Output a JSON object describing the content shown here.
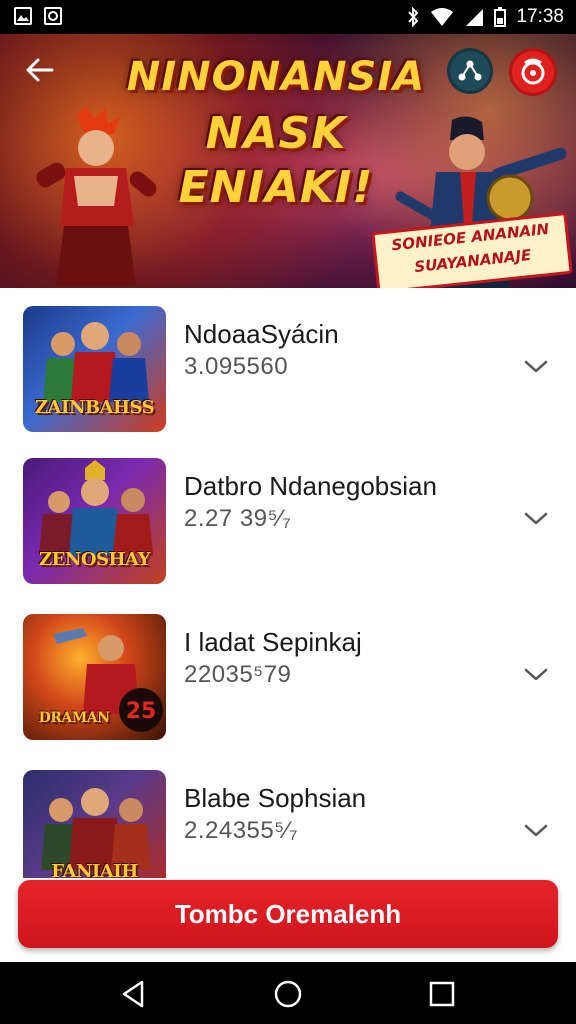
{
  "status_bar": {
    "time": "17:38"
  },
  "banner": {
    "title_line1": "NINONANSIA",
    "title_line2": "NASK",
    "title_line3": "ENIAKI!",
    "subtitle_line1": "SONIEOE ANANAIN",
    "subtitle_line2": "SUAYANANAJE"
  },
  "games": [
    {
      "name": "NdoaaSyácin",
      "count": "3.095560",
      "logo": "ZAINBAHSS",
      "thumb_colors": [
        "#1b3a8a",
        "#d23b1c"
      ]
    },
    {
      "name": "Datbro Ndanegobsian",
      "count": "2.27 39⁵⁄₇",
      "logo": "ZENOSHAY",
      "thumb_colors": [
        "#4a1a7a",
        "#c2411b"
      ]
    },
    {
      "name": "I ladat Sepinkaj",
      "count": "22035⁵79",
      "logo": "DRAMAN",
      "thumb_colors": [
        "#b3360e",
        "#3a1206"
      ]
    },
    {
      "name": "Blabe Sophsian",
      "count": "2.24355⁵⁄₇",
      "logo": "FANIAIH",
      "thumb_colors": [
        "#2a2f6a",
        "#b72a1e"
      ]
    }
  ],
  "cta": {
    "label": "Tombc Oremalenh"
  },
  "colors": {
    "accent": "#e0211e",
    "title_gold": "#ffd23a"
  },
  "icons": {
    "back": "arrow-left-icon",
    "share": "share-icon",
    "gift": "gift-icon",
    "chevron": "chevron-down-icon"
  }
}
